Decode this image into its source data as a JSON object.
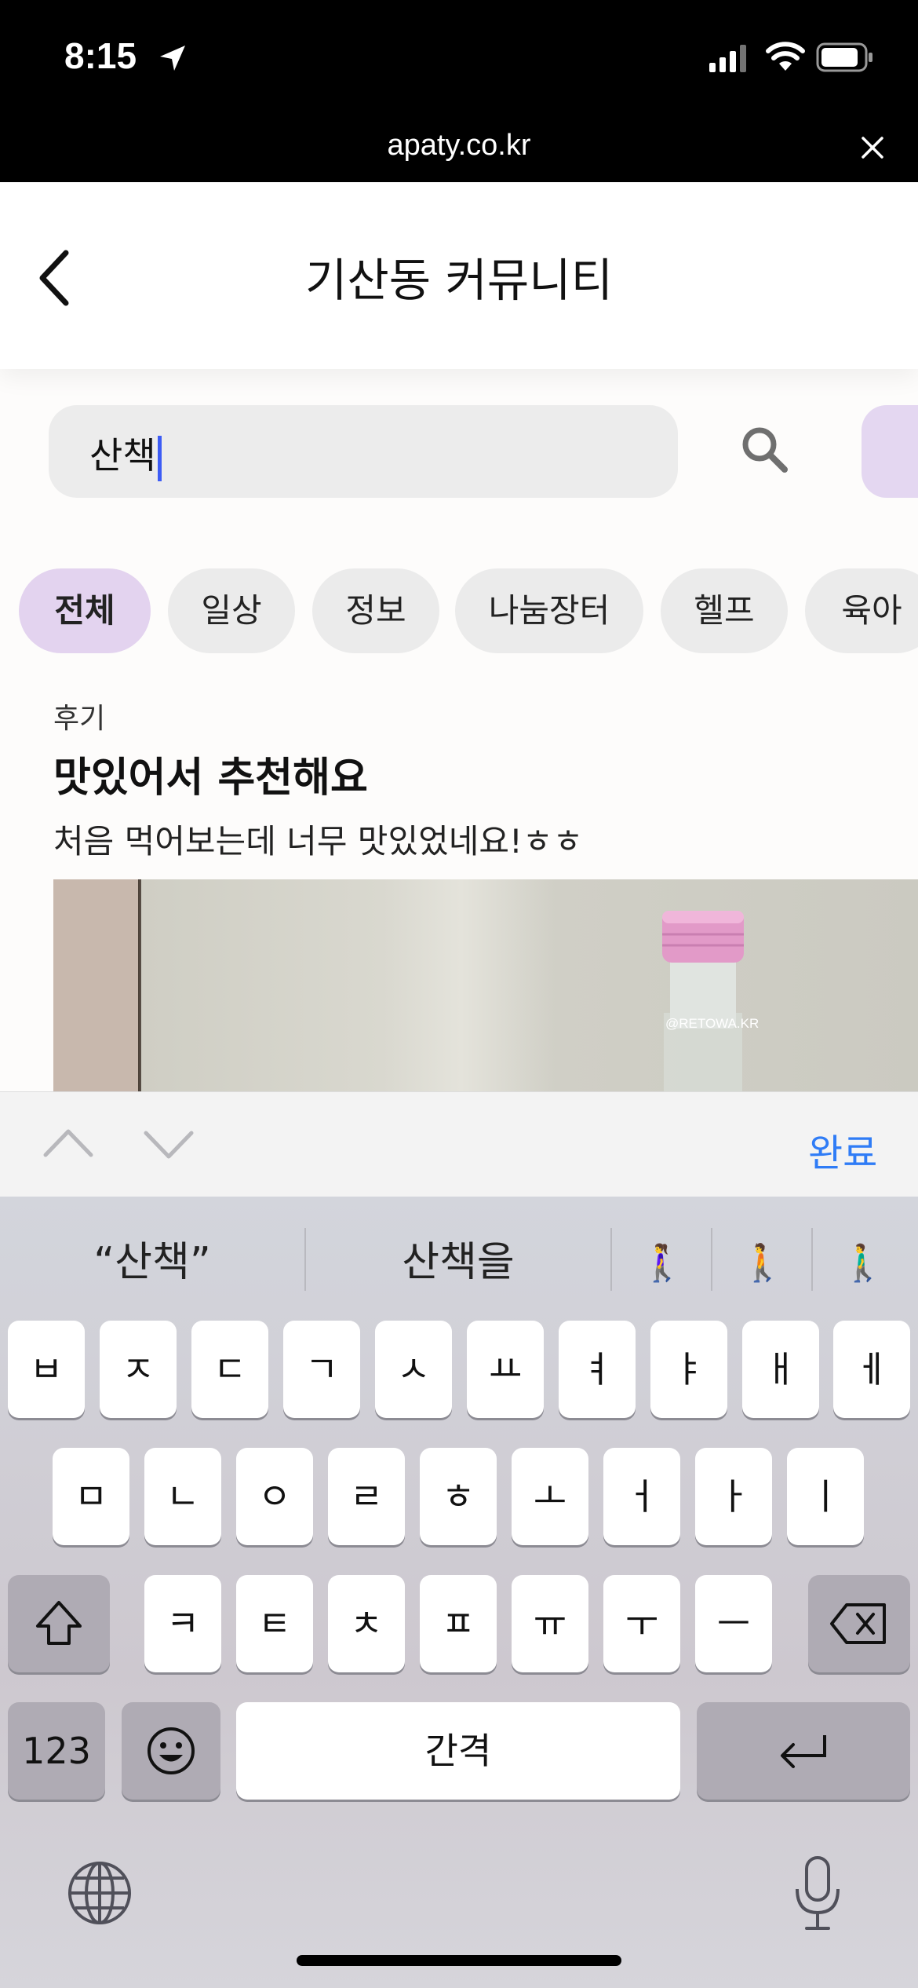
{
  "status": {
    "time": "8:15"
  },
  "browser": {
    "url": "apaty.co.kr"
  },
  "header": {
    "title": "기산동 커뮤니티"
  },
  "search": {
    "value": "산책"
  },
  "chips": [
    "전체",
    "일상",
    "정보",
    "나눔장터",
    "헬프",
    "육아"
  ],
  "post": {
    "category": "후기",
    "title": "맛있어서 추천해요",
    "body": "처음 먹어보는데 너무 맛있었네요!ㅎㅎ",
    "image_watermark": "@RETOWA.KR"
  },
  "accessory": {
    "done_label": "완료"
  },
  "keyboard": {
    "predictions": [
      "“산책”",
      "산책을"
    ],
    "emoji_predictions": [
      "🚶‍♀️",
      "🚶",
      "🚶‍♂️"
    ],
    "row1": [
      "ㅂ",
      "ㅈ",
      "ㄷ",
      "ㄱ",
      "ㅅ",
      "ㅛ",
      "ㅕ",
      "ㅑ",
      "ㅐ",
      "ㅔ"
    ],
    "row2": [
      "ㅁ",
      "ㄴ",
      "ㅇ",
      "ㄹ",
      "ㅎ",
      "ㅗ",
      "ㅓ",
      "ㅏ",
      "ㅣ"
    ],
    "row3": [
      "ㅋ",
      "ㅌ",
      "ㅊ",
      "ㅍ",
      "ㅠ",
      "ㅜ",
      "ㅡ"
    ],
    "numbers_label": "123",
    "space_label": "간격"
  },
  "colors": {
    "accent": "#2f7cf6",
    "chip_active": "#e3d3ef",
    "caret": "#3d5cf5"
  }
}
